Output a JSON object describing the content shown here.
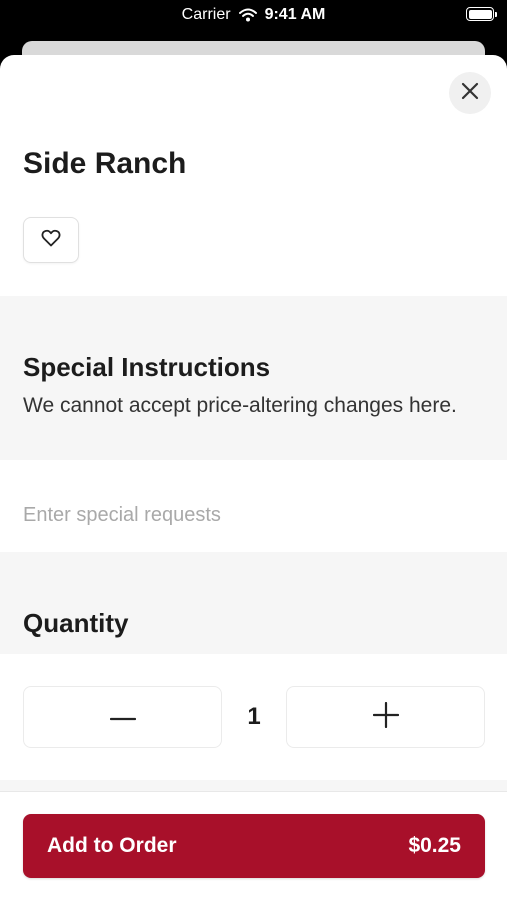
{
  "status_bar": {
    "carrier": "Carrier",
    "time": "9:41 AM",
    "wifi_icon": "wifi-icon",
    "battery_icon": "battery-icon"
  },
  "sheet": {
    "close_icon": "close-icon",
    "title": "Side Ranch",
    "favorite_icon": "heart-icon"
  },
  "special_instructions": {
    "heading": "Special Instructions",
    "subtext": "We cannot accept price-altering changes here.",
    "input_value": "",
    "input_placeholder": "Enter special requests"
  },
  "quantity": {
    "heading": "Quantity",
    "value": "1",
    "decrement_icon": "minus-icon",
    "increment_icon": "plus-icon"
  },
  "footer": {
    "add_label": "Add to Order",
    "price": "$0.25",
    "accent_color": "#a8102a"
  }
}
